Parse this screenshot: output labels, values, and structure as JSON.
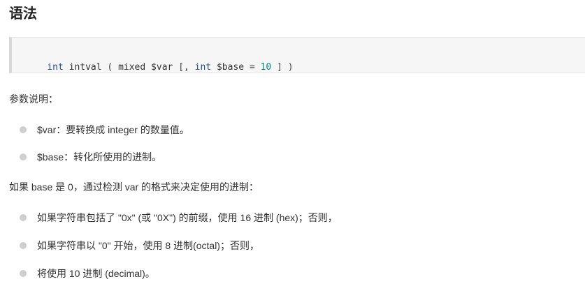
{
  "heading": "语法",
  "code": {
    "tokens": [
      {
        "t": "int",
        "c": "kw"
      },
      {
        "t": " intval ",
        "c": "id"
      },
      {
        "t": "(",
        "c": "punc"
      },
      {
        "t": " mixed ",
        "c": "id"
      },
      {
        "t": "$var ",
        "c": "var"
      },
      {
        "t": "[,",
        "c": "punc"
      },
      {
        "t": " ",
        "c": "id"
      },
      {
        "t": "int",
        "c": "kw"
      },
      {
        "t": " $base ",
        "c": "var"
      },
      {
        "t": "=",
        "c": "op"
      },
      {
        "t": " ",
        "c": "id"
      },
      {
        "t": "10",
        "c": "num"
      },
      {
        "t": " ",
        "c": "id"
      },
      {
        "t": "]",
        "c": "punc"
      },
      {
        "t": " ",
        "c": "id"
      },
      {
        "t": ")",
        "c": "punc"
      }
    ]
  },
  "params_intro": "参数说明：",
  "params": [
    "$var：要转换成 integer 的数量值。",
    "$base：转化所使用的进制。"
  ],
  "base_intro": "如果 base 是 0，通过检测 var 的格式来决定使用的进制：",
  "base_rules": [
    "如果字符串包括了 \"0x\" (或 \"0X\") 的前缀，使用 16 进制 (hex)；否则，",
    "如果字符串以 \"0\" 开始，使用 8 进制(octal)；否则，",
    "将使用 10 进制 (decimal)。"
  ]
}
